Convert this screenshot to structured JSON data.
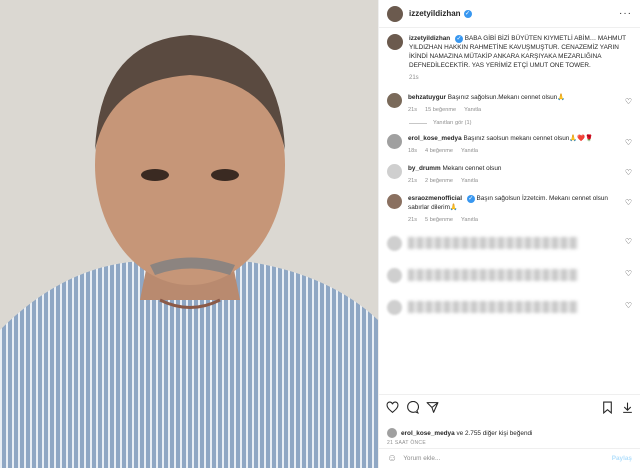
{
  "post": {
    "username": "izzetyildizhan",
    "caption": "BABA GİBİ BİZİ BÜYÜTEN KIYMETLİ ABİM… MAHMUT YILDIZHAN HAKKIN RAHMETİNE KAVUŞMUŞTUR. CENAZEMİZ YARIN İKİNDİ NAMAZINA MÜTAKİP ANKARA KARŞIYAKA MEZARLIĞINA DEFNEDİLECEKTİR. YAS YERİMİZ ETÇİ UMUT ONE TOWER.",
    "caption_time": "21s"
  },
  "comments": [
    {
      "user": "behzatuygur",
      "text": "Başınız sağolsun.Mekanı cennet olsun🙏",
      "time": "21s",
      "likes": "15 beğenme",
      "reply": "Yanıtla",
      "view_replies": "Yanıtları gör (1)"
    },
    {
      "user": "erol_kose_medya",
      "text": "Başınız saolsun mekanı cennet olsun🙏❤️🌹",
      "time": "18s",
      "likes": "4 beğenme",
      "reply": "Yanıtla"
    },
    {
      "user": "by_drumm",
      "text": "Mekanı cennet olsun",
      "time": "21s",
      "likes": "2 beğenme",
      "reply": "Yanıtla"
    },
    {
      "user": "esraozmenofficial",
      "text": "Başın sağolsun İzzetcim. Mekanı cennet olsun sabırlar dilerim🙏",
      "time": "21s",
      "likes": "5 beğenme",
      "reply": "Yanıtla"
    }
  ],
  "liked_by": {
    "user": "erol_kose_medya",
    "rest": "ve 2.755 diğer kişi beğendi"
  },
  "post_age": "21 SAAT ÖNCE",
  "comment_input": {
    "placeholder": "Yorum ekle...",
    "post_label": "Paylaş"
  },
  "colors": {
    "verified": "#3897f0",
    "muted": "#8e8e8e",
    "post_disabled": "#b2dffc"
  }
}
